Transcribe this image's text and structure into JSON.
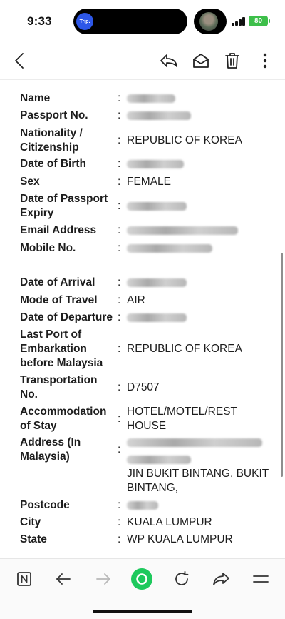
{
  "status_bar": {
    "time": "9:33",
    "island_app_label": "Trip.",
    "battery": "80"
  },
  "toolbar": {
    "back_icon": "chevron-left-icon",
    "reply_icon": "reply-icon",
    "mark_unread_icon": "envelope-open-icon",
    "delete_icon": "trash-icon",
    "more_icon": "more-vertical-icon"
  },
  "form": {
    "personal": [
      {
        "key": "name",
        "label": "Name",
        "value": ""
      },
      {
        "key": "passport",
        "label": "Passport No.",
        "value": ""
      },
      {
        "key": "nationality",
        "label": "Nationality / Citizenship",
        "value": "REPUBLIC OF KOREA"
      },
      {
        "key": "dob",
        "label": "Date of Birth",
        "value": ""
      },
      {
        "key": "sex",
        "label": "Sex",
        "value": "FEMALE"
      },
      {
        "key": "passport_expiry",
        "label": "Date of Passport Expiry",
        "value": ""
      },
      {
        "key": "email",
        "label": "Email Address",
        "value": ""
      },
      {
        "key": "mobile",
        "label": "Mobile No.",
        "value": ""
      }
    ],
    "travel": [
      {
        "key": "arrival",
        "label": "Date of Arrival",
        "value": ""
      },
      {
        "key": "mode",
        "label": "Mode of Travel",
        "value": "AIR"
      },
      {
        "key": "departure",
        "label": "Date of Departure",
        "value": ""
      },
      {
        "key": "last_port",
        "label": "Last Port of Embarkation before Malaysia",
        "value": "REPUBLIC OF KOREA"
      },
      {
        "key": "transport_no",
        "label": "Transportation No.",
        "value": "D7507"
      },
      {
        "key": "accommodation",
        "label": "Accommodation of Stay",
        "value": "HOTEL/MOTEL/REST HOUSE"
      },
      {
        "key": "address",
        "label": "Address (In Malaysia)",
        "value": "",
        "value_line2": "JIN BUKIT BINTANG, BUKIT BINTANG,"
      },
      {
        "key": "postcode",
        "label": "Postcode",
        "value": ""
      },
      {
        "key": "city",
        "label": "City",
        "value": "KUALA LUMPUR"
      },
      {
        "key": "state",
        "label": "State",
        "value": "WP KUALA LUMPUR"
      }
    ],
    "colon": ":"
  },
  "bottom_nav": {
    "items": [
      "naver-n-icon",
      "arrow-left-icon",
      "arrow-right-icon",
      "home-circle-icon",
      "reload-icon",
      "share-icon",
      "menu-icon"
    ],
    "accent_color": "#1ec95d"
  }
}
